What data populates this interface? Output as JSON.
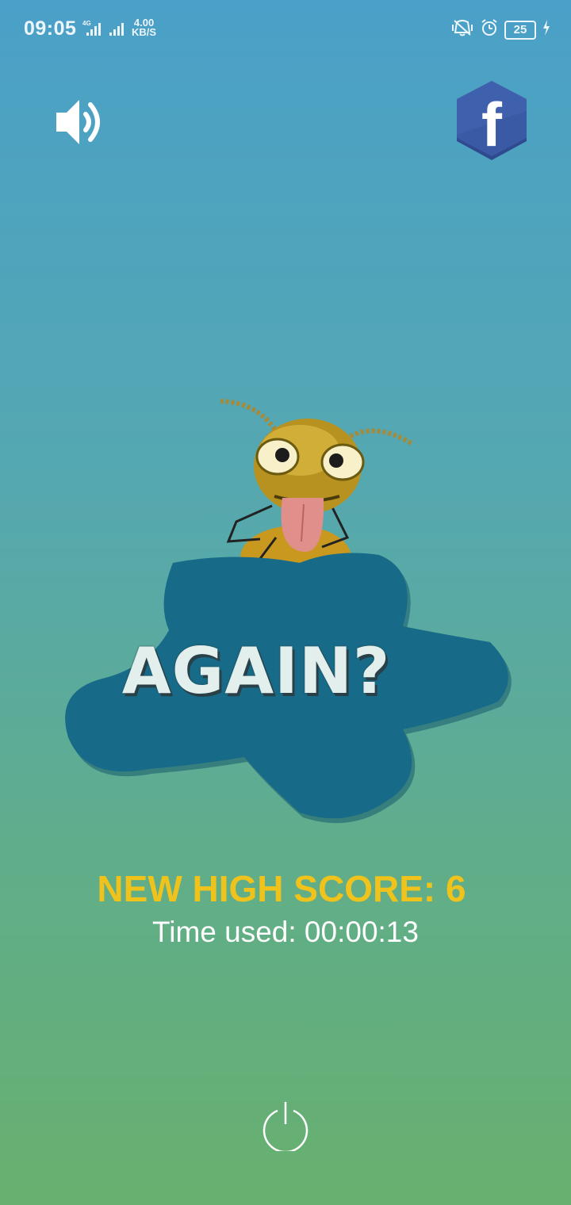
{
  "status_bar": {
    "time": "09:05",
    "network_type": "4G",
    "speed_value": "4.00",
    "speed_unit": "KB/S",
    "battery": "25",
    "icons": [
      "signal-icon",
      "vibrate-icon",
      "alarm-icon",
      "battery-icon",
      "charging-icon"
    ]
  },
  "toolbar": {
    "sound_icon": "speaker-icon",
    "facebook_icon": "facebook-icon",
    "facebook_glyph": "f"
  },
  "game_over": {
    "again_label": "AGAIN?",
    "high_score_text": "NEW HIGH SCORE: 6",
    "time_used_text": "Time used: 00:00:13"
  },
  "footer": {
    "power_icon": "power-icon"
  },
  "colors": {
    "score": "#efc21c",
    "splash": "#176b88",
    "facebook": "#3b5aa6"
  }
}
